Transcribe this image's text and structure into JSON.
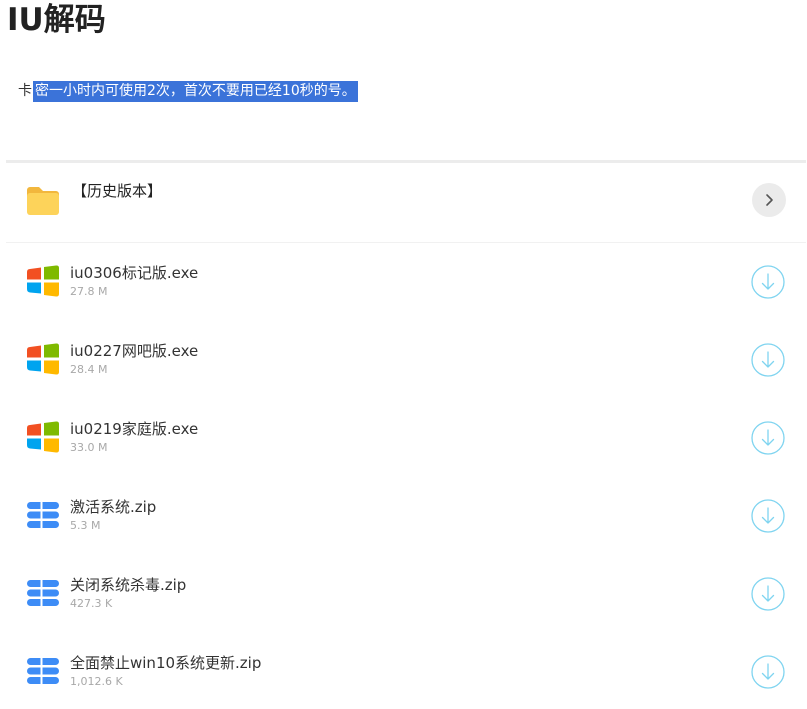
{
  "page": {
    "title": "IU解码",
    "notice_lead": "卡",
    "notice_selected": "密一小时内可使用2次，首次不要用已经10秒的号。"
  },
  "folder": {
    "label": "【历史版本】",
    "icon": "folder-icon",
    "action_icon": "chevron-right-icon"
  },
  "files": [
    {
      "name": "iu0306标记版.exe",
      "size": "27.8 M",
      "icon": "windows-icon"
    },
    {
      "name": "iu0227网吧版.exe",
      "size": "28.4 M",
      "icon": "windows-icon"
    },
    {
      "name": "iu0219家庭版.exe",
      "size": "33.0 M",
      "icon": "windows-icon"
    },
    {
      "name": "激活系统.zip",
      "size": "5.3 M",
      "icon": "archive-icon"
    },
    {
      "name": "关闭系统杀毒.zip",
      "size": "427.3 K",
      "icon": "archive-icon"
    },
    {
      "name": "全面禁止win10系统更新.zip",
      "size": "1,012.6 K",
      "icon": "archive-icon"
    }
  ],
  "colors": {
    "selection": "#3b73d9",
    "folder": "#fdd35a",
    "win_red": "#f25022",
    "win_green": "#7fba00",
    "win_blue": "#00a4ef",
    "win_yellow": "#ffb900",
    "archive_blue": "#3d8cf6",
    "download_cyan": "#7fd4f0"
  }
}
